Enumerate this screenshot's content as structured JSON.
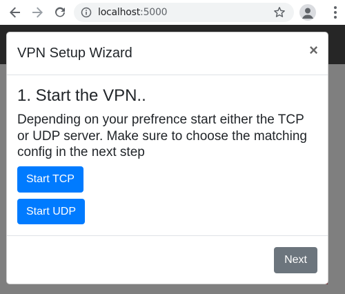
{
  "browser": {
    "url_host": "localhost",
    "url_port": ":5000"
  },
  "modal": {
    "title": "VPN Setup Wizard",
    "close_label": "×",
    "step_title": "1. Start the VPN..",
    "step_description": "Depending on your prefrence start either the TCP or UDP server. Make sure to choose the matching config in the next step",
    "buttons": {
      "start_tcp": "Start TCP",
      "start_udp": "Start UDP",
      "next": "Next"
    }
  },
  "colors": {
    "primary": "#007bff",
    "secondary": "#6c757d",
    "navbar": "#262626",
    "backdrop": "#7f7f7f"
  }
}
